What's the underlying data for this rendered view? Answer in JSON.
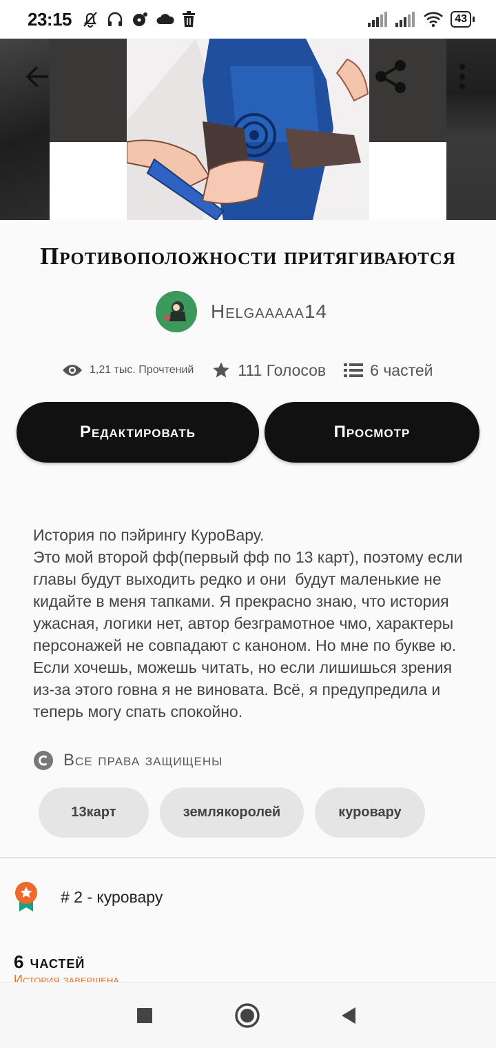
{
  "status_bar": {
    "time": "23:15",
    "battery": "43"
  },
  "toolbar": {
    "back_icon": "arrow-left-icon",
    "share_icon": "share-icon",
    "more_icon": "more-vertical-icon"
  },
  "story": {
    "title": "Противоположности притягиваются",
    "author": "Helgaaaaa14",
    "reads": "1,21 тыс. Прочтений",
    "votes": "111 Голосов",
    "parts": "6 частей"
  },
  "buttons": {
    "edit": "Редактировать",
    "view": "Просмотр"
  },
  "description": "История по пэйрингу КуроВару.\nЭто мой второй фф(первый фф по 13 карт), поэтому если главы будут выходить редко и они  будут маленькие не кидайте в меня тапками. Я прекрасно знаю, что история ужасная, логики нет, автор безграмотное чмо, характеры персонажей не совпадают с каноном. Но мне по букве ю. Если хочешь, можешь читать, но если лишишься зрения из-за этого говна я не виновата. Всё, я предупредила и теперь могу спать спокойно.",
  "rights": "Все права защищены",
  "tags": [
    "13карт",
    "землякоролей",
    "куровару"
  ],
  "rank": "# 2 - куровару",
  "parts_section": {
    "title": "6 частей",
    "status": "История завершена"
  },
  "colors": {
    "accent": "#e8702a",
    "button_bg": "#121112",
    "tag_bg": "#e6e5e6"
  }
}
